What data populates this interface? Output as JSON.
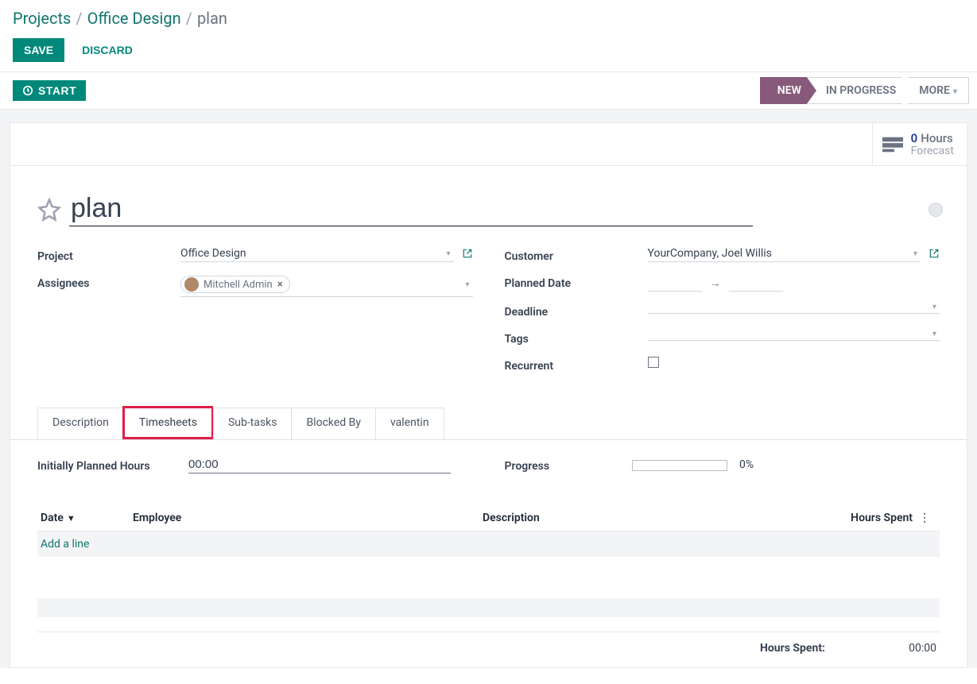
{
  "breadcrumb": {
    "root": "Projects",
    "project": "Office Design",
    "current": "plan"
  },
  "buttons": {
    "save": "SAVE",
    "discard": "DISCARD",
    "start": "START"
  },
  "stages": {
    "new": "NEW",
    "in_progress": "IN PROGRESS",
    "more": "MORE"
  },
  "forecast": {
    "count": "0",
    "unit": "Hours",
    "sub": "Forecast"
  },
  "task": {
    "name_value": "plan"
  },
  "labels": {
    "project": "Project",
    "assignees": "Assignees",
    "customer": "Customer",
    "planned_date": "Planned Date",
    "deadline": "Deadline",
    "tags": "Tags",
    "recurrent": "Recurrent",
    "initially_planned": "Initially Planned Hours",
    "progress": "Progress"
  },
  "fields": {
    "project": "Office Design",
    "assignee_name": "Mitchell Admin",
    "customer": "YourCompany, Joel Willis"
  },
  "tabs": {
    "description": "Description",
    "timesheets": "Timesheets",
    "subtasks": "Sub-tasks",
    "blocked_by": "Blocked By",
    "valentin": "valentin"
  },
  "timesheet": {
    "planned_value": "00:00",
    "progress_pct": "0%",
    "columns": {
      "date": "Date",
      "employee": "Employee",
      "description": "Description",
      "hours_spent": "Hours Spent"
    },
    "add_line": "Add a line",
    "total_label": "Hours Spent:",
    "total_value": "00:00"
  }
}
